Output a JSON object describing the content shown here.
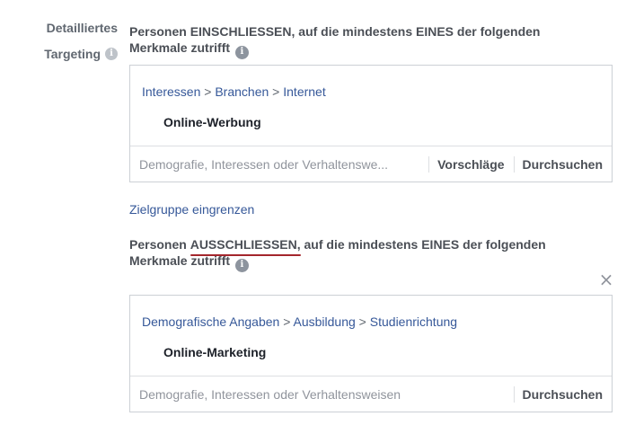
{
  "sidebar_label": {
    "line1": "Detailliertes",
    "line2": "Targeting",
    "info_icon": "info-icon"
  },
  "include": {
    "prefix": "Personen ",
    "keyword": "EINSCHLIESSEN",
    "suffix": ", auf die mindestens EINES der folgenden Merkmale zutrifft",
    "breadcrumb": [
      "Interessen",
      "Branchen",
      "Internet"
    ],
    "breadcrumb_separator": " > ",
    "selected_item": "Online-Werbung",
    "search_placeholder": "Demografie, Interessen oder Verhaltenswe...",
    "suggestions_label": "Vorschläge",
    "browse_label": "Durchsuchen"
  },
  "narrow_audience_link": "Zielgruppe eingrenzen",
  "exclude": {
    "prefix": "Personen ",
    "keyword": "AUSSCHLIESSEN",
    "suffix": ", auf die mindestens EINES der folgenden Merkmale zutrifft",
    "breadcrumb": [
      "Demografische Angaben",
      "Ausbildung",
      "Studienrichtung"
    ],
    "breadcrumb_separator": " > ",
    "selected_item": "Online-Marketing",
    "search_placeholder": "Demografie, Interessen oder Verhaltensweisen",
    "browse_label": "Durchsuchen",
    "close_icon": "close-icon",
    "close_glyph": "×"
  },
  "colors": {
    "link": "#365899",
    "text": "#4b4f56",
    "underline": "#a4262c",
    "border": "#ccd0d5"
  }
}
